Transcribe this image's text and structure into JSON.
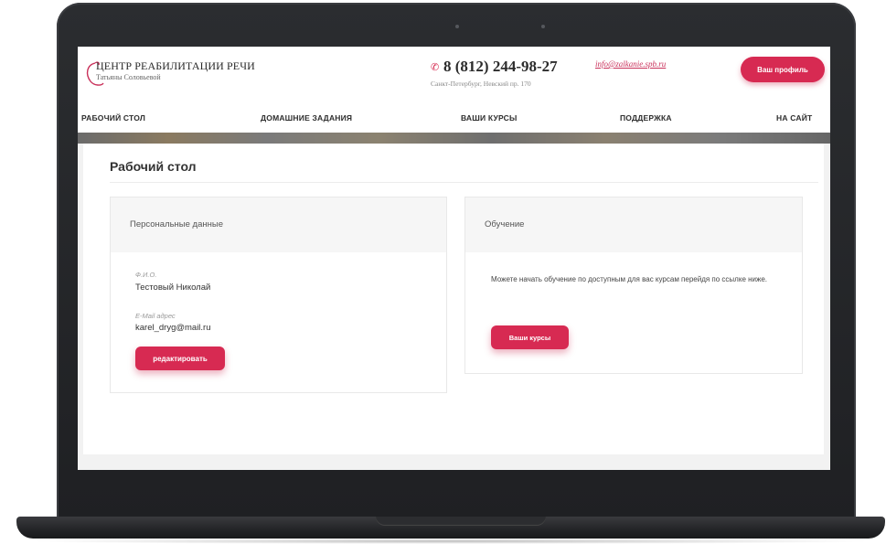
{
  "header": {
    "logo_title": "ЦЕНТР РЕАБИЛИТАЦИИ РЕЧИ",
    "logo_subtitle": "Татьяны Соловьевой",
    "phone": "8 (812) 244-98-27",
    "address": "Санкт-Петербург, Невский пр. 170",
    "email": "info@zalkanie.spb.ru",
    "profile_button": "Ваш профиль"
  },
  "nav": {
    "items": [
      {
        "label": "РАБОЧИЙ СТОЛ"
      },
      {
        "label": "ДОМАШНИЕ ЗАДАНИЯ"
      },
      {
        "label": "ВАШИ КУРСЫ"
      },
      {
        "label": "ПОДДЕРЖКА"
      },
      {
        "label": "НА САЙТ"
      }
    ]
  },
  "main": {
    "page_title": "Рабочий стол",
    "personal": {
      "heading": "Персональные данные",
      "name_label": "Ф.И.О.",
      "name_value": "Тестовый Николай",
      "email_label": "E-Mail адрес",
      "email_value": "karel_dryg@mail.ru",
      "edit_button": "редактировать"
    },
    "learning": {
      "heading": "Обучение",
      "text": "Можете начать обучение по доступным для вас курсам перейдя по ссылке ниже.",
      "courses_button": "Ваши курсы"
    }
  },
  "colors": {
    "accent": "#d72a52",
    "frame": "#232427"
  },
  "icons": [
    "phone-icon",
    "logo-swirl-icon"
  ]
}
